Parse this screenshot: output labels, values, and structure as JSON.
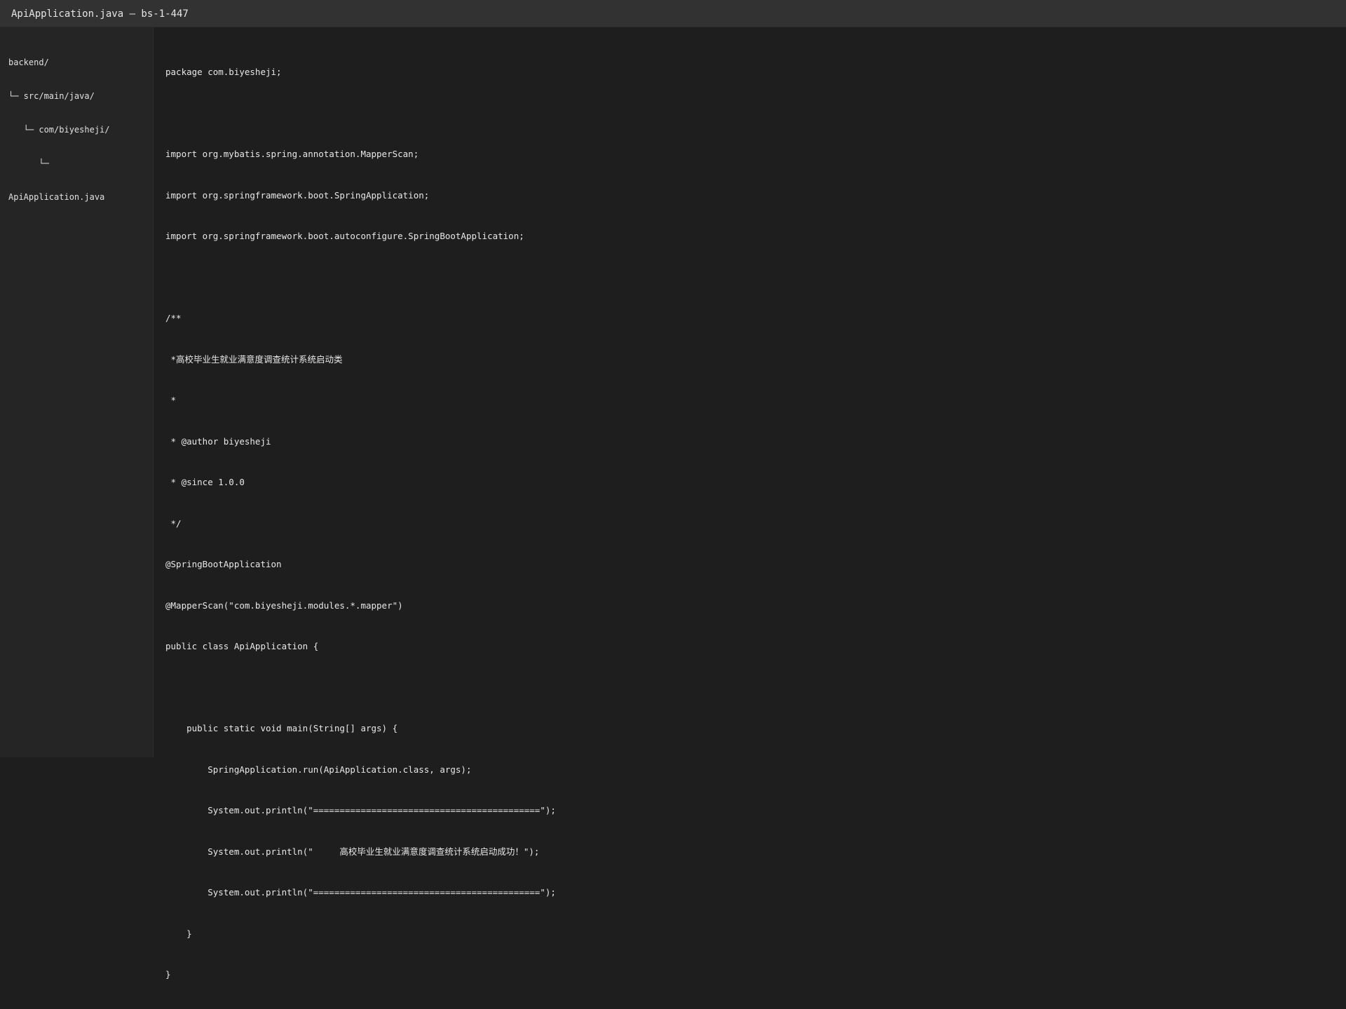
{
  "window": {
    "title": "ApiApplication.java — bs-1-447"
  },
  "sidebar": {
    "tree": [
      "backend/",
      "└─ src/main/java/",
      "   └─ com/biyesheji/",
      "      └─",
      "ApiApplication.java"
    ]
  },
  "editor": {
    "lines": [
      "package com.biyesheji;",
      "",
      "import org.mybatis.spring.annotation.MapperScan;",
      "import org.springframework.boot.SpringApplication;",
      "import org.springframework.boot.autoconfigure.SpringBootApplication;",
      "",
      "/**",
      " *高校毕业生就业满意度调查统计系统启动类",
      " *",
      " * @author biyesheji",
      " * @since 1.0.0",
      " */",
      "@SpringBootApplication",
      "@MapperScan(\"com.biyesheji.modules.*.mapper\")",
      "public class ApiApplication {",
      "",
      "    public static void main(String[] args) {",
      "        SpringApplication.run(ApiApplication.class, args);",
      "        System.out.println(\"===========================================\");",
      "        System.out.println(\"     高校毕业生就业满意度调查统计系统启动成功！\");",
      "        System.out.println(\"===========================================\");",
      "    }",
      "}"
    ]
  }
}
